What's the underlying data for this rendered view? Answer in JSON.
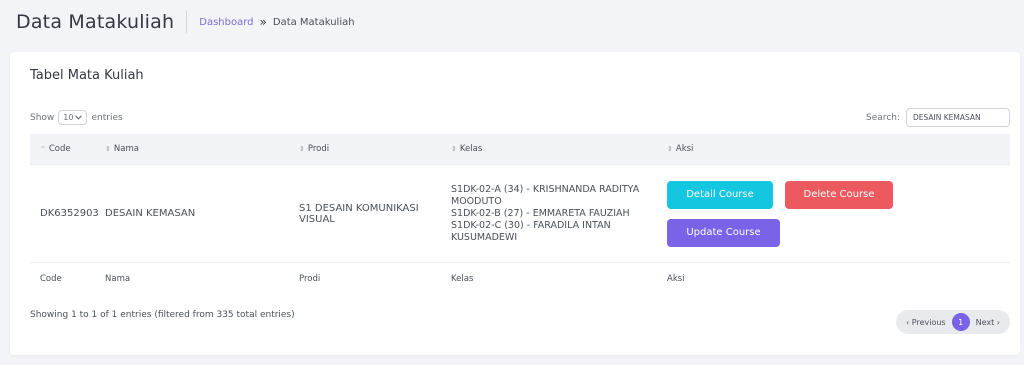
{
  "header": {
    "title": "Data Matakuliah",
    "breadcrumb": {
      "home": "Dashboard",
      "separator": "»",
      "current": "Data Matakuliah"
    }
  },
  "card": {
    "title": "Tabel Mata Kuliah",
    "length": {
      "prefix": "Show",
      "value": "10",
      "suffix": "entries"
    },
    "search": {
      "label": "Search:",
      "value": "DESAIN KEMASAN"
    }
  },
  "table": {
    "headers": {
      "code": "Code",
      "nama": "Nama",
      "prodi": "Prodi",
      "kelas": "Kelas",
      "aksi": "Aksi"
    },
    "rows": [
      {
        "code": "DK6352903",
        "nama": "DESAIN KEMASAN",
        "prodi": "S1 DESAIN KOMUNIKASI VISUAL",
        "kelas": [
          "S1DK-02-A (34) - KRISHNANDA RADITYA MOODUTO",
          "S1DK-02-B (27) - EMMARETA FAUZIAH",
          "S1DK-02-C (30) - FARADILA INTAN KUSUMADEWI"
        ],
        "actions": {
          "detail": "Detail Course",
          "delete": "Delete Course",
          "update": "Update Course"
        }
      }
    ]
  },
  "footer": {
    "info": "Showing 1 to 1 of 1 entries (filtered from 335 total entries)",
    "pagination": {
      "previous": "‹ Previous",
      "current_page": "1",
      "next": "Next ›"
    }
  },
  "colors": {
    "accent": "#7a63e6",
    "detail_button": "#14c6e0",
    "delete_button": "#ec5a5f",
    "link": "#7b6bd9"
  }
}
